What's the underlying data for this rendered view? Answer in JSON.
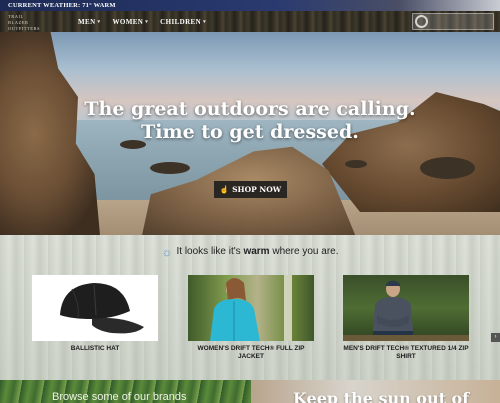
{
  "weather_bar": {
    "text": "CURRENT WEATHER: 71° WARM"
  },
  "logo": {
    "line1": "TRAIL BLAZER",
    "line2": "OUTFITTERS"
  },
  "nav": {
    "items": [
      {
        "label": "MEN"
      },
      {
        "label": "WOMEN"
      },
      {
        "label": "CHILDREN"
      }
    ]
  },
  "hero": {
    "title_line1": "The great outdoors are calling.",
    "title_line2": "Time to get dressed.",
    "cta_label": "SHOP NOW"
  },
  "weather_message": {
    "prefix": "It looks like it's ",
    "highlight": "warm",
    "suffix": " where you are."
  },
  "products": [
    {
      "title": "BALLISTIC HAT"
    },
    {
      "title": "WOMEN'S DRIFT TECH® FULL ZIP JACKET"
    },
    {
      "title": "MEN'S DRIFT TECH® TEXTURED 1/4 ZIP SHIRT"
    }
  ],
  "banners": {
    "left": "Browse some of our brands",
    "right": "Keep the sun out of"
  },
  "icons": {
    "weather": "sun-icon",
    "search": "search-icon",
    "cta": "hand-pointer-icon",
    "scroll": "chevron-right-icon"
  },
  "colors": {
    "weather_bar": "#1d2a55",
    "cta_bg": "#2a2722",
    "sun": "#5b8fc9"
  }
}
